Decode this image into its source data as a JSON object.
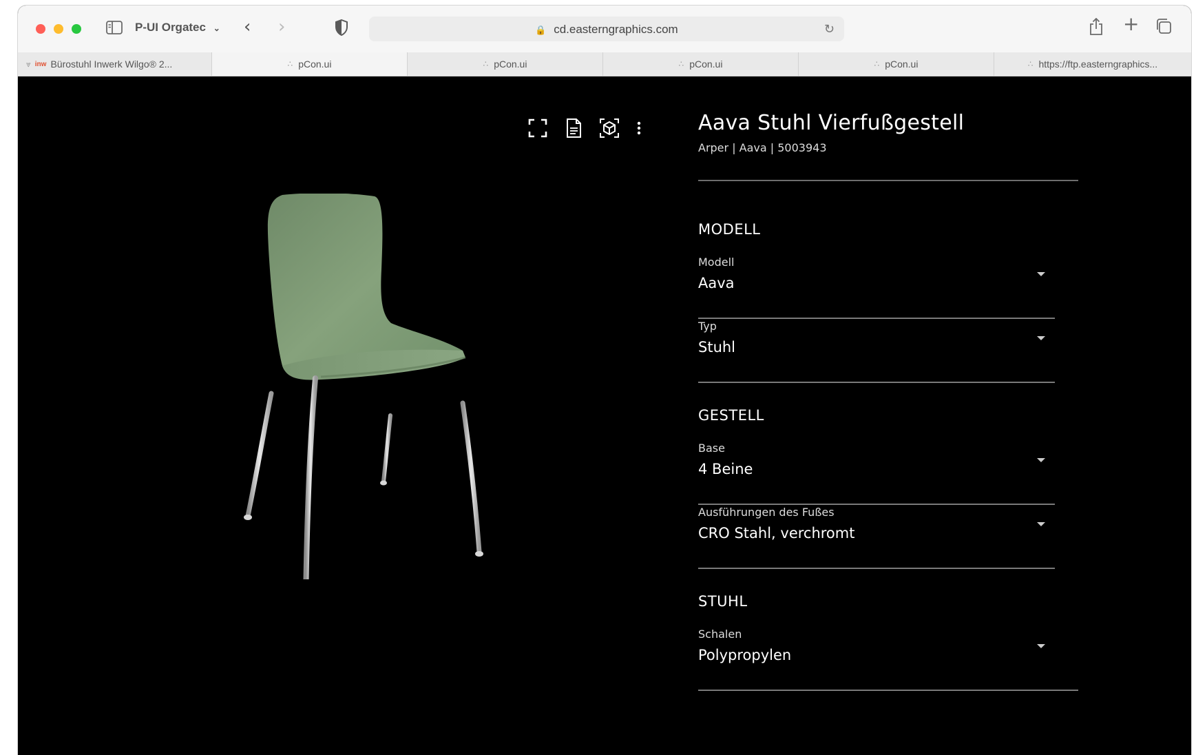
{
  "browser": {
    "profile_label": "P-UI Orgatec",
    "url": "cd.easterngraphics.com",
    "tabs": [
      {
        "label": "Bürostuhl Inwerk Wilgo® 2...",
        "brand": "inw"
      },
      {
        "label": "pCon.ui"
      },
      {
        "label": "pCon.ui"
      },
      {
        "label": "pCon.ui"
      },
      {
        "label": "pCon.ui"
      },
      {
        "label": "https://ftp.easterngraphics..."
      }
    ]
  },
  "product": {
    "title": "Aava Stuhl Vierfußgestell",
    "subtitle": "Arper | Aava | 5003943"
  },
  "sections": [
    {
      "name": "MODELL"
    },
    {
      "name": "GESTELL"
    },
    {
      "name": "STUHL"
    }
  ],
  "fields": [
    {
      "label": "Modell",
      "value": "Aava"
    },
    {
      "label": "Typ",
      "value": "Stuhl"
    },
    {
      "label": "Base",
      "value": "4 Beine"
    },
    {
      "label": "Ausführungen des Fußes",
      "value": "CRO Stahl, verchromt"
    },
    {
      "label": "Schalen",
      "value": "Polypropylen"
    }
  ],
  "colors": {
    "chair_shell": "#7f9b76",
    "chair_legs": "#c9c9c9",
    "viewer_background": "#000000"
  }
}
